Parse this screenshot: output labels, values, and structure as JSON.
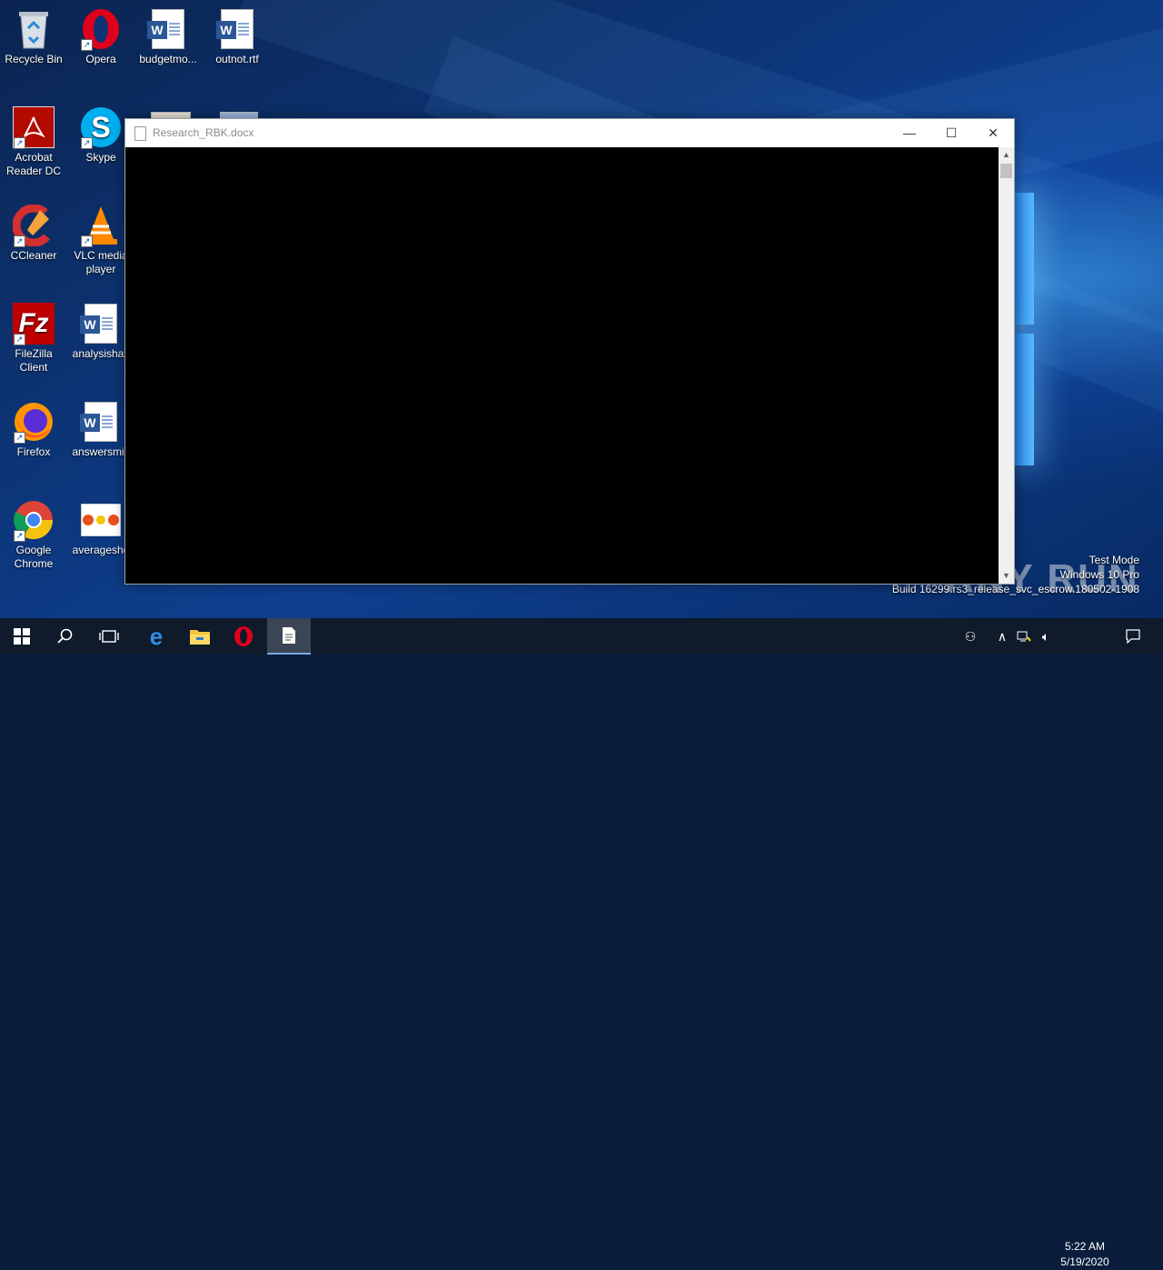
{
  "desktop": {
    "icons": [
      {
        "label": "Recycle Bin"
      },
      {
        "label": "Opera"
      },
      {
        "label": "budgetmo..."
      },
      {
        "label": "outnot.rtf"
      },
      {
        "label": "Acrobat Reader DC"
      },
      {
        "label": "Skype"
      },
      {
        "label": "CCleaner"
      },
      {
        "label": "VLC media player"
      },
      {
        "label": "FileZilla Client"
      },
      {
        "label": "analysishav"
      },
      {
        "label": "Firefox"
      },
      {
        "label": "answersmik"
      },
      {
        "label": "Google Chrome"
      },
      {
        "label": "averagesho"
      }
    ]
  },
  "window": {
    "title": "Research_RBK.docx",
    "minimize_glyph": "—",
    "maximize_glyph": "☐",
    "close_glyph": "✕"
  },
  "watermark": {
    "line1": "Test Mode",
    "line2": "Windows 10 Pro",
    "line3": "Build 16299.rs3_release_svc_escrow.180502-1908",
    "brand": "ANY RUN"
  },
  "taskbar": {
    "items": [
      "start-icon",
      "search-icon",
      "task-view-icon",
      "edge-icon",
      "file-explorer-icon",
      "opera-icon",
      "document-icon"
    ],
    "clock_time": "5:22 AM",
    "clock_date": "5/19/2020"
  },
  "colors": {
    "accent": "#2b5797",
    "taskbar": "#0f1a2a"
  }
}
